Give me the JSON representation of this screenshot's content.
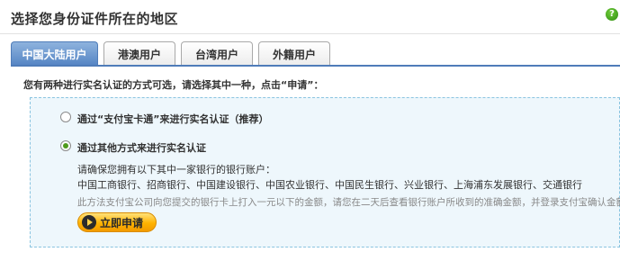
{
  "page": {
    "title": "选择您身份证件所在的地区",
    "help_icon": "question-mark-icon"
  },
  "tabs": [
    {
      "label": "中国大陆用户",
      "active": true
    },
    {
      "label": "港澳用户",
      "active": false
    },
    {
      "label": "台湾用户",
      "active": false
    },
    {
      "label": "外籍用户",
      "active": false
    }
  ],
  "instruction": "您有两种进行实名认证的方式可选，请选择其中一种，点击“申请”：",
  "options": [
    {
      "label": "通过“支付宝卡通”来进行实名认证（推荐）",
      "selected": false
    },
    {
      "label": "通过其他方式来进行实名认证",
      "selected": true
    }
  ],
  "bank_info": {
    "prompt": "请确保您拥有以下其中一家银行的银行账户：",
    "banks": "中国工商银行、招商银行、中国建设银行、中国农业银行、中国民生银行、兴业银行、上海浦东发展银行、交通银行",
    "note": "此方法支付宝公司向您提交的银行卡上打入一元以下的金额，请您在二天后查看银行账户所收到的准确金额，并登录支付宝确认金额。"
  },
  "apply_button": {
    "label": "立即申请",
    "icon": "play-icon"
  },
  "colors": {
    "active_tab": "#5484c4",
    "box_border": "#8ac4e0",
    "box_bg": "#eef7fc",
    "button": "#ffb300",
    "help": "#3a9a16"
  }
}
